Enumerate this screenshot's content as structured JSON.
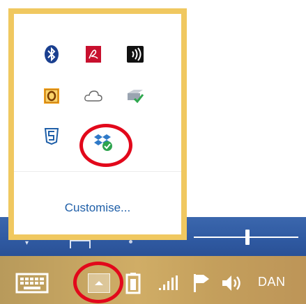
{
  "flyout": {
    "customise_label": "Customise...",
    "icons": [
      "bluetooth-icon",
      "adobe-reader-icon",
      "audio-device-icon",
      "outlook-icon",
      "onedrive-icon",
      "printer-check-icon",
      "html5-shield-icon",
      "dropbox-synced-icon"
    ]
  },
  "taskbar": {
    "user_label": "DAN",
    "icons": [
      "touch-keyboard-icon",
      "show-hidden-icons-button",
      "battery-icon",
      "network-signal-icon",
      "action-center-flag-icon",
      "volume-icon"
    ]
  },
  "colors": {
    "flyout_border": "#f0c860",
    "highlight_ring": "#e2081b",
    "link": "#1f5fa8",
    "taskbar": "#c9a660",
    "window_band": "#2f59a1"
  }
}
